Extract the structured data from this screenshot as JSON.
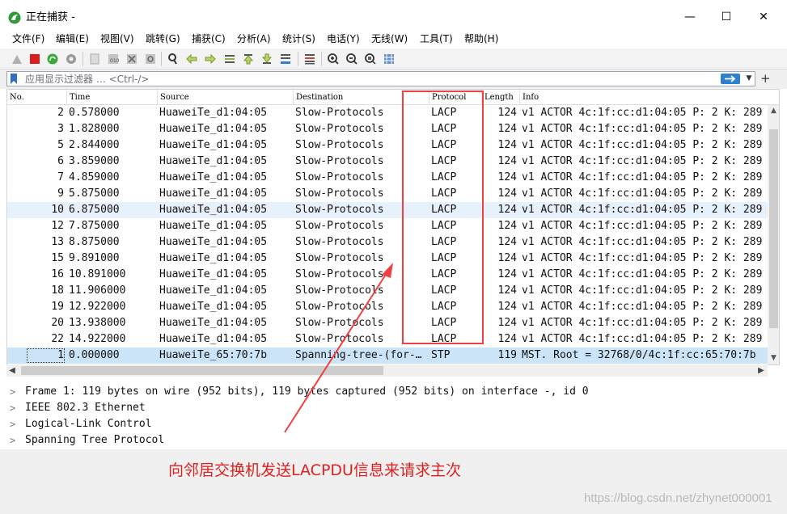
{
  "window": {
    "title": "正在捕获 -",
    "controls": [
      "—",
      "☐",
      "✕"
    ]
  },
  "menu": [
    "文件(F)",
    "编辑(E)",
    "视图(V)",
    "跳转(G)",
    "捕获(C)",
    "分析(A)",
    "统计(S)",
    "电话(Y)",
    "无线(W)",
    "工具(T)",
    "帮助(H)"
  ],
  "filter": {
    "placeholder": "应用显示过滤器 … <Ctrl-/>"
  },
  "columns": [
    "No.",
    "Time",
    "Source",
    "Destination",
    "Protocol",
    "Length",
    "Info"
  ],
  "packets": [
    {
      "no": "2",
      "time": "0.578000",
      "src": "HuaweiTe_d1:04:05",
      "dst": "Slow-Protocols",
      "proto": "LACP",
      "len": "124",
      "info": "v1 ACTOR 4c:1f:cc:d1:04:05 P: 2 K: 289"
    },
    {
      "no": "3",
      "time": "1.828000",
      "src": "HuaweiTe_d1:04:05",
      "dst": "Slow-Protocols",
      "proto": "LACP",
      "len": "124",
      "info": "v1 ACTOR 4c:1f:cc:d1:04:05 P: 2 K: 289"
    },
    {
      "no": "5",
      "time": "2.844000",
      "src": "HuaweiTe_d1:04:05",
      "dst": "Slow-Protocols",
      "proto": "LACP",
      "len": "124",
      "info": "v1 ACTOR 4c:1f:cc:d1:04:05 P: 2 K: 289"
    },
    {
      "no": "6",
      "time": "3.859000",
      "src": "HuaweiTe_d1:04:05",
      "dst": "Slow-Protocols",
      "proto": "LACP",
      "len": "124",
      "info": "v1 ACTOR 4c:1f:cc:d1:04:05 P: 2 K: 289"
    },
    {
      "no": "7",
      "time": "4.859000",
      "src": "HuaweiTe_d1:04:05",
      "dst": "Slow-Protocols",
      "proto": "LACP",
      "len": "124",
      "info": "v1 ACTOR 4c:1f:cc:d1:04:05 P: 2 K: 289"
    },
    {
      "no": "9",
      "time": "5.875000",
      "src": "HuaweiTe_d1:04:05",
      "dst": "Slow-Protocols",
      "proto": "LACP",
      "len": "124",
      "info": "v1 ACTOR 4c:1f:cc:d1:04:05 P: 2 K: 289"
    },
    {
      "no": "10",
      "time": "6.875000",
      "src": "HuaweiTe_d1:04:05",
      "dst": "Slow-Protocols",
      "proto": "LACP",
      "len": "124",
      "info": "v1 ACTOR 4c:1f:cc:d1:04:05 P: 2 K: 289"
    },
    {
      "no": "12",
      "time": "7.875000",
      "src": "HuaweiTe_d1:04:05",
      "dst": "Slow-Protocols",
      "proto": "LACP",
      "len": "124",
      "info": "v1 ACTOR 4c:1f:cc:d1:04:05 P: 2 K: 289"
    },
    {
      "no": "13",
      "time": "8.875000",
      "src": "HuaweiTe_d1:04:05",
      "dst": "Slow-Protocols",
      "proto": "LACP",
      "len": "124",
      "info": "v1 ACTOR 4c:1f:cc:d1:04:05 P: 2 K: 289"
    },
    {
      "no": "15",
      "time": "9.891000",
      "src": "HuaweiTe_d1:04:05",
      "dst": "Slow-Protocols",
      "proto": "LACP",
      "len": "124",
      "info": "v1 ACTOR 4c:1f:cc:d1:04:05 P: 2 K: 289"
    },
    {
      "no": "16",
      "time": "10.891000",
      "src": "HuaweiTe_d1:04:05",
      "dst": "Slow-Protocols",
      "proto": "LACP",
      "len": "124",
      "info": "v1 ACTOR 4c:1f:cc:d1:04:05 P: 2 K: 289"
    },
    {
      "no": "18",
      "time": "11.906000",
      "src": "HuaweiTe_d1:04:05",
      "dst": "Slow-Protocols",
      "proto": "LACP",
      "len": "124",
      "info": "v1 ACTOR 4c:1f:cc:d1:04:05 P: 2 K: 289"
    },
    {
      "no": "19",
      "time": "12.922000",
      "src": "HuaweiTe_d1:04:05",
      "dst": "Slow-Protocols",
      "proto": "LACP",
      "len": "124",
      "info": "v1 ACTOR 4c:1f:cc:d1:04:05 P: 2 K: 289"
    },
    {
      "no": "20",
      "time": "13.938000",
      "src": "HuaweiTe_d1:04:05",
      "dst": "Slow-Protocols",
      "proto": "LACP",
      "len": "124",
      "info": "v1 ACTOR 4c:1f:cc:d1:04:05 P: 2 K: 289"
    },
    {
      "no": "22",
      "time": "14.922000",
      "src": "HuaweiTe_d1:04:05",
      "dst": "Slow-Protocols",
      "proto": "LACP",
      "len": "124",
      "info": "v1 ACTOR 4c:1f:cc:d1:04:05 P: 2 K: 289"
    },
    {
      "no": "1",
      "time": "0.000000",
      "src": "HuaweiTe_65:70:7b",
      "dst": "Spanning-tree-(for-…",
      "proto": "STP",
      "len": "119",
      "info": "MST. Root = 32768/0/4c:1f:cc:65:70:7b"
    }
  ],
  "details": [
    "Frame 1: 119 bytes on wire (952 bits), 119 bytes captured (952 bits) on interface -, id 0",
    "IEEE 802.3 Ethernet",
    "Logical-Link Control",
    "Spanning Tree Protocol"
  ],
  "annotation": "向邻居交换机发送LACPDU信息来请求主次",
  "watermark": "https://blog.csdn.net/zhynet000001"
}
